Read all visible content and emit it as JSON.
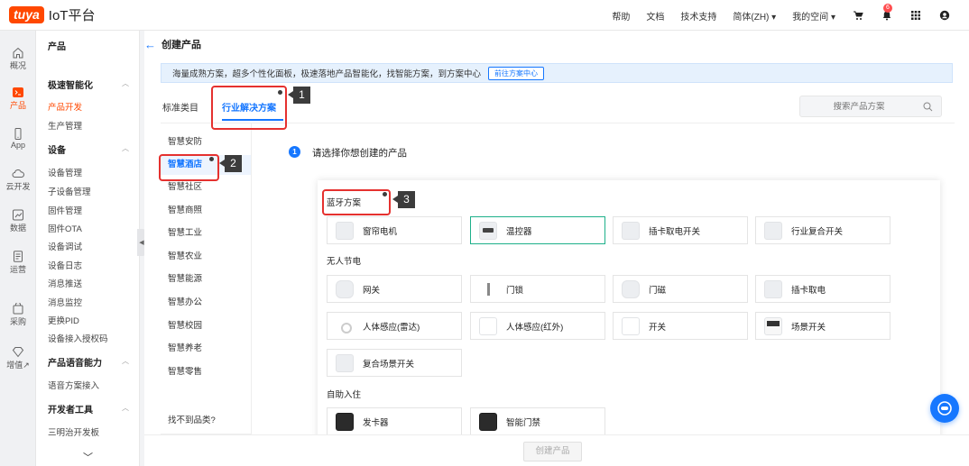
{
  "brand": {
    "logo_badge": "tuya",
    "title": "IoT平台"
  },
  "topnav": {
    "help": "帮助",
    "docs": "文档",
    "support": "技术支持",
    "language": "简体(ZH) ▾",
    "workspace": "我的空间 ▾",
    "notification_count": "6"
  },
  "rail": [
    {
      "label": "概况",
      "icon": "home-icon"
    },
    {
      "label": "产品",
      "icon": "terminal-icon"
    },
    {
      "label": "App",
      "icon": "phone-icon"
    },
    {
      "label": "云开发",
      "icon": "cloud-icon"
    },
    {
      "label": "数据",
      "icon": "chart-icon"
    },
    {
      "label": "运营",
      "icon": "document-icon"
    },
    {
      "label": "采购",
      "icon": "cart-icon"
    },
    {
      "label": "增值↗",
      "icon": "diamond-icon"
    }
  ],
  "subnav": {
    "title": "产品",
    "groups": [
      {
        "title": "极速智能化",
        "items": [
          "产品开发",
          "生产管理"
        ]
      },
      {
        "title": "设备",
        "items": [
          "设备管理",
          "子设备管理",
          "固件管理",
          "固件OTA",
          "设备调试",
          "设备日志",
          "消息推送",
          "消息监控",
          "更换PID",
          "设备接入授权码"
        ]
      },
      {
        "title": "产品语音能力",
        "items": [
          "语音方案接入"
        ]
      },
      {
        "title": "开发者工具",
        "items": [
          "三明治开发板"
        ]
      }
    ]
  },
  "page": {
    "title": "创建产品",
    "banner_text": "海量成熟方案，超多个性化面板，极速落地产品智能化，找智能方案，到方案中心",
    "banner_button": "前往方案中心",
    "tabs": [
      "标准类目",
      "行业解决方案"
    ],
    "search_placeholder": "搜索产品方案",
    "categories": [
      "智慧安防",
      "智慧酒店",
      "智慧社区",
      "智慧商照",
      "智慧工业",
      "智慧农业",
      "智慧能源",
      "智慧办公",
      "智慧校园",
      "智慧养老",
      "智慧零售"
    ],
    "category_missing": "找不到品类?",
    "step_number": "1",
    "step_label": "请选择你想创建的产品",
    "create_button": "创建产品"
  },
  "solutions": {
    "sections": [
      {
        "title": "蓝牙方案",
        "items": [
          {
            "label": "窗帘电机",
            "icon": "curtain-motor-icon"
          },
          {
            "label": "温控器",
            "icon": "thermostat-icon"
          },
          {
            "label": "插卡取电开关",
            "icon": "card-power-switch-icon"
          },
          {
            "label": "行业复合开关",
            "icon": "composite-switch-icon"
          }
        ]
      },
      {
        "title": "无人节电",
        "items": [
          {
            "label": "网关",
            "icon": "gateway-icon"
          },
          {
            "label": "门锁",
            "icon": "door-lock-icon"
          },
          {
            "label": "门磁",
            "icon": "door-sensor-icon"
          },
          {
            "label": "插卡取电",
            "icon": "card-power-icon"
          },
          {
            "label": "人体感应(雷达)",
            "icon": "radar-sensor-icon"
          },
          {
            "label": "人体感应(红外)",
            "icon": "pir-sensor-icon"
          },
          {
            "label": "开关",
            "icon": "switch-icon"
          },
          {
            "label": "场景开关",
            "icon": "scene-switch-icon"
          },
          {
            "label": "复合场景开关",
            "icon": "composite-scene-switch-icon"
          }
        ]
      },
      {
        "title": "自助入住",
        "items": [
          {
            "label": "发卡器",
            "icon": "card-issuer-icon"
          },
          {
            "label": "智能门禁",
            "icon": "access-control-icon"
          }
        ]
      }
    ],
    "selected": "温控器"
  },
  "annotations": [
    "1",
    "2",
    "3"
  ],
  "colors": {
    "brand": "#ff4800",
    "primary": "#1677ff",
    "annotation": "#e5312f",
    "selected_border": "#1db08a"
  }
}
